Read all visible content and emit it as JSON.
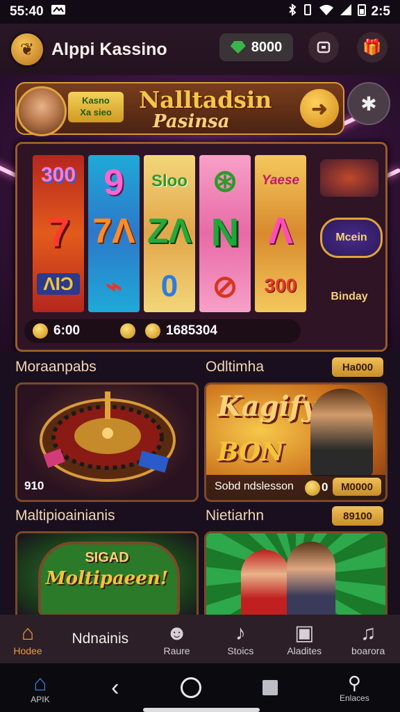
{
  "status_bar": {
    "time": "55:40",
    "battery_text": "2:5"
  },
  "header": {
    "app_title": "Alppi Kassino",
    "balance": "8000"
  },
  "hero": {
    "badge_line1": "Kasno",
    "badge_line2": "Xa sieo",
    "banner_title": "Nalltadsin",
    "banner_subtitle": "Pasinsa",
    "reel_symbols": [
      [
        "300",
        "7",
        "ΛΙϽ"
      ],
      [
        "9",
        "7Λ",
        "⌁"
      ],
      [
        "Sloo",
        "ΖΛ",
        "0"
      ],
      [
        "⊛",
        "Ν",
        "⊘"
      ],
      [
        "Yaese",
        "Λ",
        "300"
      ]
    ],
    "side_labels": [
      "",
      "Mcein",
      "Binday"
    ],
    "stat_left": "6:00",
    "stat_right": "1685304"
  },
  "sections": [
    {
      "title": "Moraanpabs",
      "card_caption": "910"
    },
    {
      "title": "Odltimha",
      "pill": "Ha000",
      "card_title": "Kagify",
      "card_sub": "BON",
      "card_caption": "Sobd ndslesson",
      "card_caption_coin": "0",
      "card_pill": "M0000"
    },
    {
      "title": "Maltipioainianis",
      "card_title": "SIGAD",
      "card_sub": "Moltipaeen!"
    },
    {
      "title": "Nietiarhn",
      "pill": "89100"
    }
  ],
  "bottom_nav": [
    {
      "label": "Hodee",
      "icon": "house-icon"
    },
    {
      "label": "Ndnainis",
      "icon": ""
    },
    {
      "label": "Raure",
      "icon": "face-icon"
    },
    {
      "label": "Stoics",
      "icon": "music-note-icon"
    },
    {
      "label": "Aladites",
      "icon": "box-icon"
    },
    {
      "label": "boarora",
      "icon": "music-note-icon"
    }
  ],
  "system_nav": {
    "home_label": "APIK",
    "search_label": "Enlaces"
  },
  "colors": {
    "accent_gold": "#f0c05a",
    "background": "#1a0f1e",
    "nav_active": "#f09a3a"
  }
}
